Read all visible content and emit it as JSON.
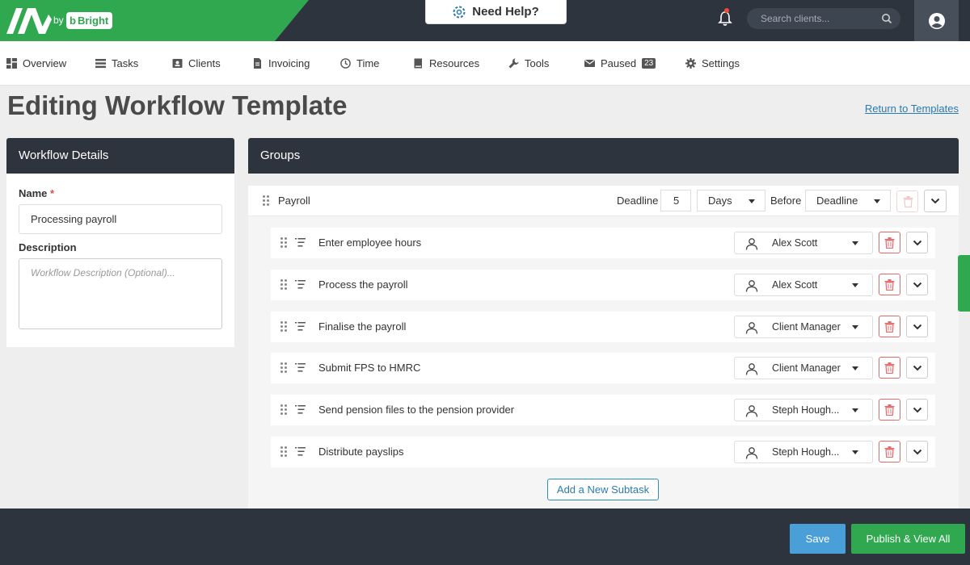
{
  "brand": {
    "by": "by",
    "partner": "Bright"
  },
  "header": {
    "help_label": "Need Help?",
    "search_placeholder": "Search clients..."
  },
  "nav": [
    {
      "label": "Overview",
      "icon": "overview-icon"
    },
    {
      "label": "Tasks",
      "icon": "tasks-icon"
    },
    {
      "label": "Clients",
      "icon": "clients-icon"
    },
    {
      "label": "Invoicing",
      "icon": "invoicing-icon"
    },
    {
      "label": "Time",
      "icon": "clock-icon"
    },
    {
      "label": "Resources",
      "icon": "book-icon"
    },
    {
      "label": "Tools",
      "icon": "wrench-icon"
    },
    {
      "label": "Paused",
      "icon": "envelope-icon",
      "badge": "23"
    },
    {
      "label": "Settings",
      "icon": "gear-icon"
    }
  ],
  "page": {
    "title": "Editing Workflow Template",
    "return_link": "Return to Templates"
  },
  "details": {
    "heading": "Workflow Details",
    "name_label": "Name",
    "required_mark": "*",
    "name_value": "Processing payroll",
    "description_label": "Description",
    "description_placeholder": "Workflow Description (Optional)..."
  },
  "groups": {
    "heading": "Groups",
    "group": {
      "name": "Payroll",
      "deadline_label": "Deadline",
      "deadline_value": "5",
      "unit": "Days",
      "before_label": "Before",
      "reference": "Deadline"
    },
    "subtasks": [
      {
        "title": "Enter employee hours",
        "assignee": "Alex Scott"
      },
      {
        "title": "Process the payroll",
        "assignee": "Alex Scott"
      },
      {
        "title": "Finalise the payroll",
        "assignee": "Client Manager"
      },
      {
        "title": "Submit FPS to HMRC",
        "assignee": "Client Manager"
      },
      {
        "title": "Send pension files to the pension provider",
        "assignee": "Steph Hough..."
      },
      {
        "title": "Distribute payslips",
        "assignee": "Steph Hough..."
      }
    ],
    "add_subtask_label": "Add a New Subtask"
  },
  "footer": {
    "save_label": "Save",
    "publish_label": "Publish & View All"
  },
  "colors": {
    "brand_green": "#2fa84f",
    "dark": "#2d343e",
    "save_blue": "#4a9fd8",
    "danger": "#e36a6a"
  }
}
